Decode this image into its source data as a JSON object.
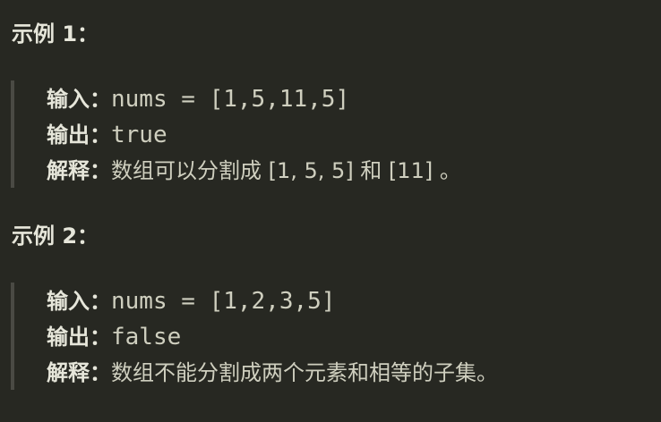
{
  "examples": [
    {
      "title": "示例 1：",
      "input_label": "输入：",
      "input_value": "nums = [1,5,11,5]",
      "output_label": "输出：",
      "output_value": "true",
      "explain_label": "解释：",
      "explain_value": "数组可以分割成 [1, 5, 5] 和 [11] 。"
    },
    {
      "title": "示例 2：",
      "input_label": "输入：",
      "input_value": "nums = [1,2,3,5]",
      "output_label": "输出：",
      "output_value": "false",
      "explain_label": "解释：",
      "explain_value": "数组不能分割成两个元素和相等的子集。"
    }
  ]
}
